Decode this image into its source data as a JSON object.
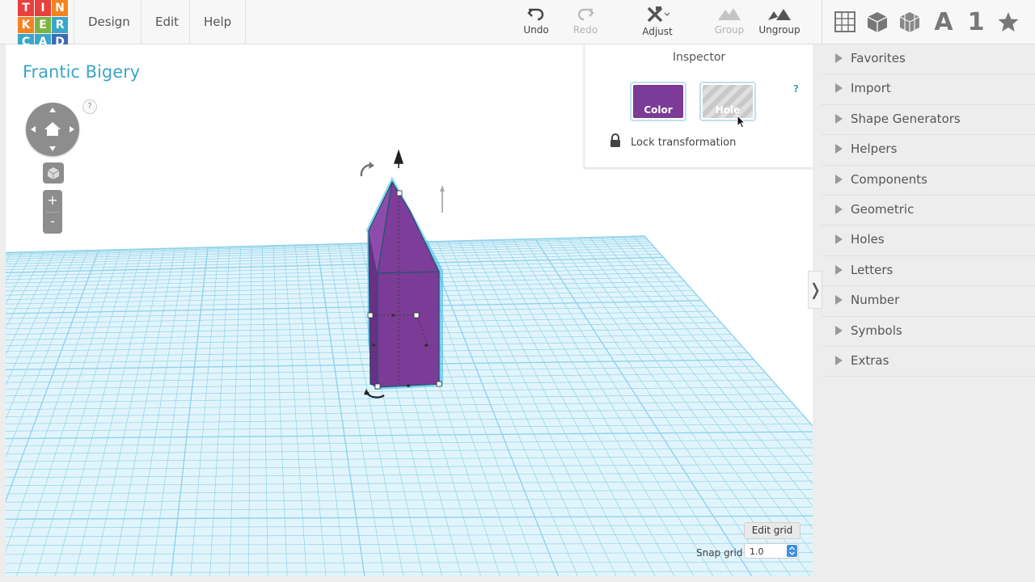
{
  "logo": {
    "letters": [
      "T",
      "I",
      "N",
      "K",
      "E",
      "R",
      "C",
      "A",
      "D"
    ],
    "colors": [
      "#e8403c",
      "#e8403c",
      "#f58221",
      "#f58221",
      "#7cb342",
      "#3aa6c9",
      "#3aa6c9",
      "#3aa6c9",
      "#3d6ab3"
    ]
  },
  "menu": {
    "design": "Design",
    "edit": "Edit",
    "help": "Help"
  },
  "toolbar": {
    "undo": "Undo",
    "redo": "Redo",
    "adjust": "Adjust",
    "group": "Group",
    "ungroup": "Ungroup"
  },
  "shape_tools": {
    "text_glyph": "A",
    "number_glyph": "1",
    "icons": [
      "grid-icon",
      "box-icon",
      "wireframe-box-icon",
      "letter-icon",
      "number-icon",
      "star-icon"
    ]
  },
  "design": {
    "title": "Frantic Bigery"
  },
  "view_controls": {
    "help": "?",
    "zoom_in": "+",
    "zoom_out": "-"
  },
  "inspector": {
    "title": "Inspector",
    "help": "?",
    "color_label": "Color",
    "hole_label": "Hole",
    "lock_label": "Lock transformation",
    "color_value": "#7b3b97"
  },
  "grid": {
    "edit_label": "Edit grid",
    "snap_label": "Snap grid",
    "snap_value": "1.0"
  },
  "sidebar": {
    "toggle": "❭",
    "categories": [
      {
        "label": "Favorites"
      },
      {
        "label": "Import"
      },
      {
        "label": "Shape Generators"
      },
      {
        "label": "Helpers"
      },
      {
        "label": "Components"
      },
      {
        "label": "Geometric"
      },
      {
        "label": "Holes"
      },
      {
        "label": "Letters"
      },
      {
        "label": "Number"
      },
      {
        "label": "Symbols"
      },
      {
        "label": "Extras"
      }
    ]
  },
  "colors": {
    "accent": "#3aa6c9",
    "grid_line": "#8fd3ea",
    "shape": "#7b3b97",
    "selection": "#35b4e6"
  }
}
